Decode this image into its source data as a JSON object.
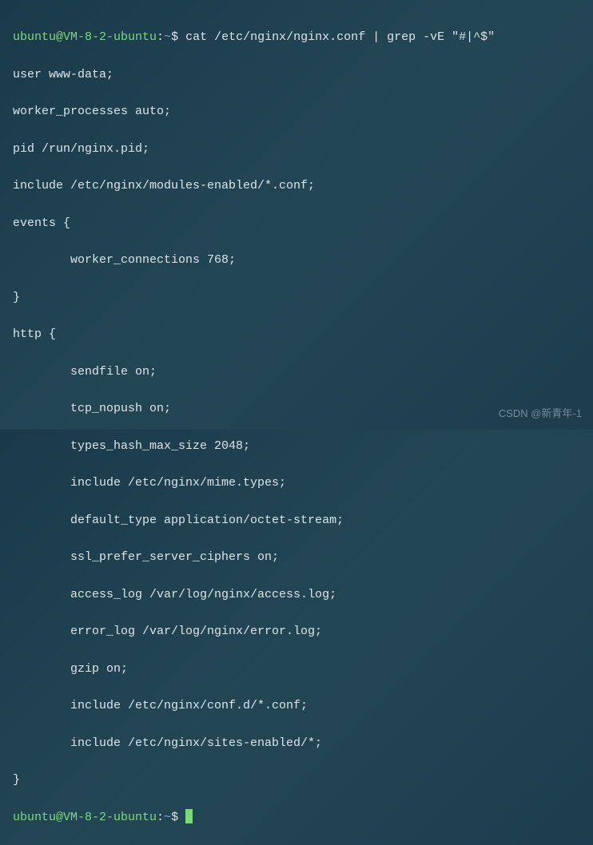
{
  "prompt": {
    "userhost": "ubuntu@VM-8-2-ubuntu",
    "sep": ":",
    "path": "~",
    "dollar": "$"
  },
  "command1": " cat /etc/nginx/nginx.conf | grep -vE \"#|^$\"",
  "output": {
    "l0": "user www-data;",
    "l1": "worker_processes auto;",
    "l2": "pid /run/nginx.pid;",
    "l3": "include /etc/nginx/modules-enabled/*.conf;",
    "l4": "events {",
    "l5": "        worker_connections 768;",
    "l6": "}",
    "l7": "http {",
    "l8": "        sendfile on;",
    "l9": "        tcp_nopush on;",
    "l10": "        types_hash_max_size 2048;",
    "l11": "        include /etc/nginx/mime.types;",
    "l12": "        default_type application/octet-stream;",
    "l13": "        ssl_prefer_server_ciphers on;",
    "l14": "        access_log /var/log/nginx/access.log;",
    "l15": "        error_log /var/log/nginx/error.log;",
    "l16": "        gzip on;",
    "l17": "        include /etc/nginx/conf.d/*.conf;",
    "l18": "        include /etc/nginx/sites-enabled/*;",
    "l19": "}"
  },
  "command2": " ",
  "watermark": "CSDN @新青年-1"
}
